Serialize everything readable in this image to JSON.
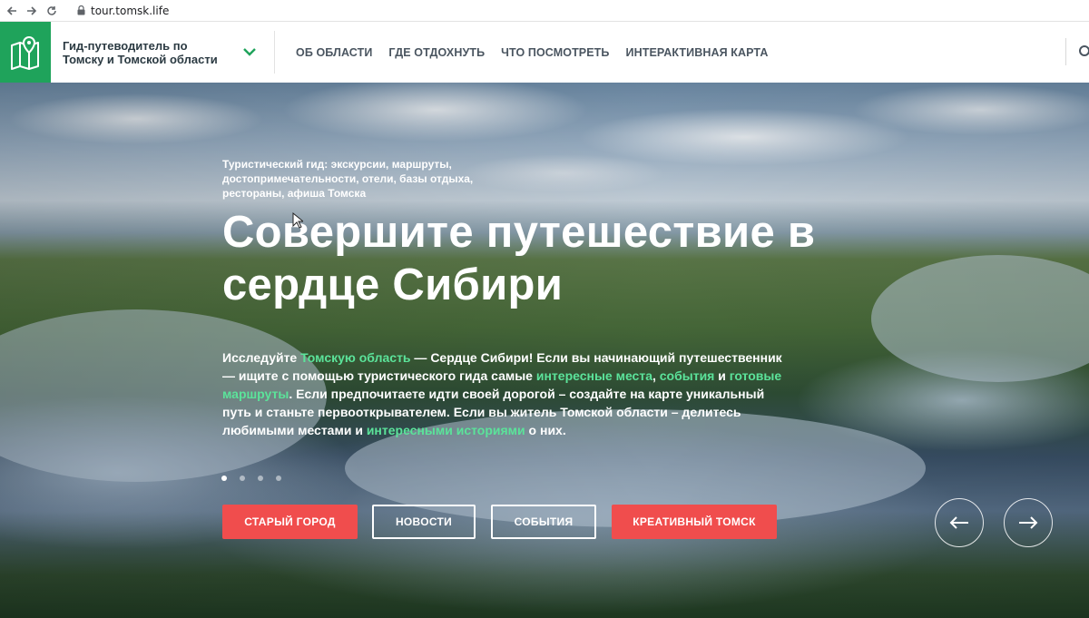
{
  "browser": {
    "url": "tour.tomsk.life",
    "icons": [
      "back-arrow-icon",
      "forward-arrow-icon",
      "reload-icon",
      "lock-icon"
    ]
  },
  "header": {
    "title_line1": "Гид-путеводитель по",
    "title_line2": "Томску и Томской области",
    "logo_icon": "map-pin-icon",
    "chevron_icon": "chevron-down-icon",
    "search_icon": "search-icon",
    "nav": [
      {
        "label": "ОБ ОБЛАСТИ"
      },
      {
        "label": "ГДЕ ОТДОХНУТЬ"
      },
      {
        "label": "ЧТО ПОСМОТРЕТЬ"
      },
      {
        "label": "ИНТЕРАКТИВНАЯ КАРТА"
      }
    ],
    "colors": {
      "logo_bg": "#1fa35b",
      "nav_text": "#4a5560",
      "title_text": "#2b3a42"
    }
  },
  "hero": {
    "kicker_line1": "Туристический гид: экскурсии, маршруты,",
    "kicker_line2": "достопримечательности, отели, базы отдыха,",
    "kicker_line3": "рестораны, афиша Томска",
    "headline_line1": "Совершите путешествие в",
    "headline_line2": "сердце Сибири",
    "lead": {
      "t1": "Исследуйте ",
      "l1": "Томскую область",
      "t2": " — Сердце Сибири! Если вы начинающий путешественник — ищите с помощью туристического гида самые ",
      "l2": "интересные места",
      "t3": ", ",
      "l3": "события",
      "t4": " и ",
      "l4": "готовые маршруты",
      "t5": ". Если предпочитаете идти своей дорогой – создайте на карте уникальный путь и станьте первооткрывателем. Если вы житель Томской области – делитесь любимыми местами и ",
      "l5": "интересными историями",
      "t6": " о них."
    },
    "slides_total": 4,
    "active_slide": 1,
    "buttons": [
      {
        "label": "СТАРЫЙ ГОРОД",
        "style": "filled"
      },
      {
        "label": "НОВОСТИ",
        "style": "outline"
      },
      {
        "label": "СОБЫТИЯ",
        "style": "outline"
      },
      {
        "label": "КРЕАТИВНЫЙ ТОМСК",
        "style": "filled"
      }
    ],
    "prev_icon": "arrow-left-icon",
    "next_icon": "arrow-right-icon",
    "colors": {
      "button_red": "#f04d4d",
      "link_green": "#5be39a"
    }
  }
}
